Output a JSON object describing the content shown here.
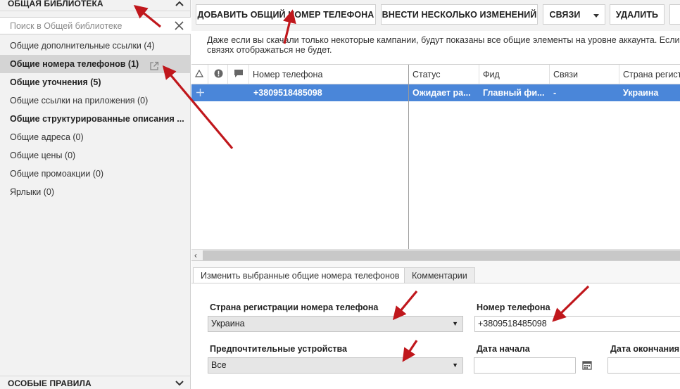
{
  "sidebar": {
    "title": "ОБЩАЯ БИБЛИОТЕКА",
    "search_placeholder": "Поиск в Общей библиотеке",
    "items": [
      {
        "label": "Общие дополнительные ссылки (4)",
        "bold": false,
        "selected": false
      },
      {
        "label": "Общие номера телефонов (1)",
        "bold": true,
        "selected": true
      },
      {
        "label": "Общие уточнения (5)",
        "bold": true,
        "selected": false
      },
      {
        "label": "Общие ссылки на приложения (0)",
        "bold": false,
        "selected": false
      },
      {
        "label": "Общие структурированные описания ...",
        "bold": true,
        "selected": false
      },
      {
        "label": "Общие адреса (0)",
        "bold": false,
        "selected": false
      },
      {
        "label": "Общие цены (0)",
        "bold": false,
        "selected": false
      },
      {
        "label": "Общие промоакции (0)",
        "bold": false,
        "selected": false
      },
      {
        "label": "Ярлыки (0)",
        "bold": false,
        "selected": false
      }
    ],
    "bottom_section": "ОСОБЫЕ ПРАВИЛА"
  },
  "toolbar": {
    "add_label": "ДОБАВИТЬ ОБЩИЙ НОМЕР ТЕЛЕФОНА",
    "multi_edit_label": "ВНЕСТИ НЕСКОЛЬКО ИЗМЕНЕНИЙ",
    "links_label": "СВЯЗИ",
    "delete_label": "УДАЛИТЬ"
  },
  "notice": {
    "line1": "Даже если вы скачали только некоторые кампании, будут показаны все общие элементы на уровне аккаунта. Если и",
    "line2": "связях отображаться не будет."
  },
  "grid": {
    "columns": {
      "phone": "Номер телефона",
      "status": "Статус",
      "feed": "Фид",
      "links": "Связи",
      "country": "Страна регист"
    },
    "row": {
      "phone": "+3809518485098",
      "status": "Ожидает ра...",
      "feed": "Главный фи...",
      "links": "-",
      "country": "Украина"
    }
  },
  "editor": {
    "tab_edit": "Изменить выбранные общие номера телефонов",
    "tab_comments": "Комментарии",
    "country_label": "Страна регистрации номера телефона",
    "country_value": "Украина",
    "phone_label": "Номер телефона",
    "phone_value": "+3809518485098",
    "devices_label": "Предпочтительные устройства",
    "devices_value": "Все",
    "start_label": "Дата начала",
    "start_value": "",
    "end_label": "Дата окончания",
    "end_value": ""
  },
  "colors": {
    "selection": "#4a86d9",
    "annotation_arrow": "#c0171c",
    "sidebar_bg": "#f2f2f2"
  },
  "icons": [
    "chevron-up-icon",
    "chevron-down-icon",
    "close-icon",
    "external-link-icon",
    "sort-triangle-icon",
    "warning-icon",
    "comment-icon",
    "plus-icon",
    "calendar-icon",
    "dropdown-caret-icon"
  ]
}
